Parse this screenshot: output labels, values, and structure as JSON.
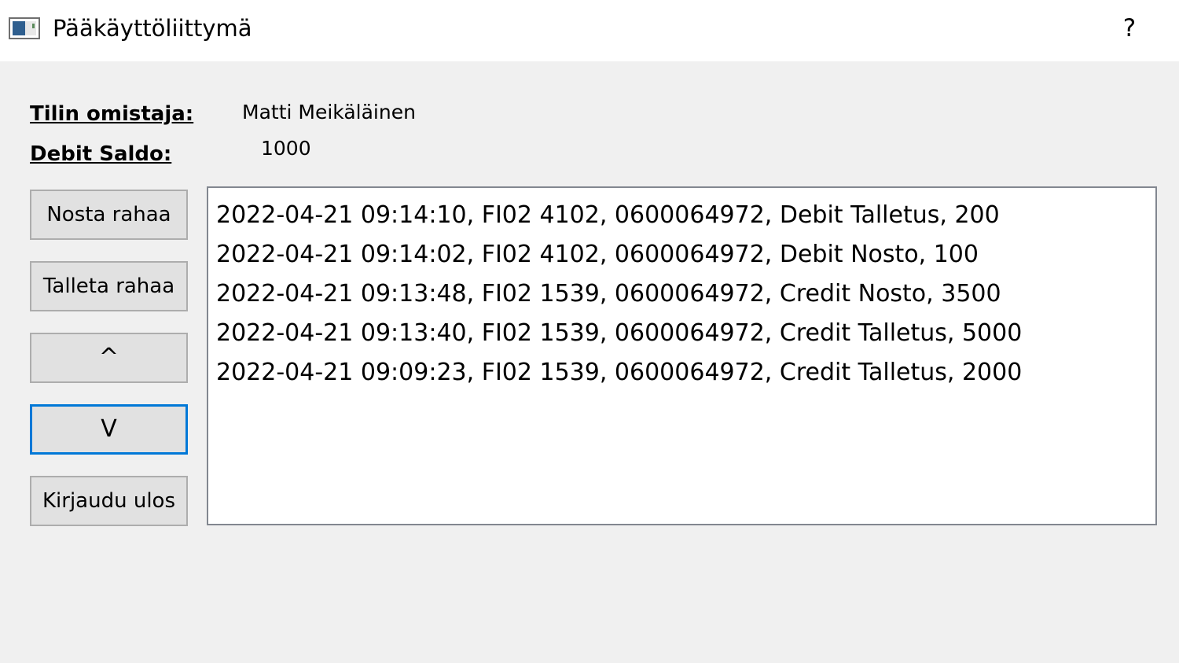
{
  "window": {
    "title": "Pääkäyttöliittymä",
    "help_label": "?"
  },
  "account": {
    "owner_label": "Tilin omistaja:",
    "owner_value": "Matti Meikäläinen",
    "balance_label": "Debit Saldo:",
    "balance_value": "1000"
  },
  "buttons": {
    "withdraw": "Nosta rahaa",
    "deposit": "Talleta rahaa",
    "up": "^",
    "down": "V",
    "logout": "Kirjaudu ulos"
  },
  "transactions": [
    "2022-04-21 09:14:10, FI02 4102, 0600064972, Debit Talletus, 200",
    "2022-04-21 09:14:02, FI02 4102, 0600064972, Debit Nosto, 100",
    "2022-04-21 09:13:48, FI02 1539, 0600064972, Credit Nosto, 3500",
    "2022-04-21 09:13:40, FI02 1539, 0600064972, Credit Talletus, 5000",
    "2022-04-21 09:09:23, FI02 1539, 0600064972, Credit Talletus, 2000"
  ],
  "icons": {
    "app": "window-app-icon"
  },
  "colors": {
    "focus_border": "#0078d7",
    "button_face": "#e1e1e1",
    "window_background": "#f0f0f0"
  }
}
